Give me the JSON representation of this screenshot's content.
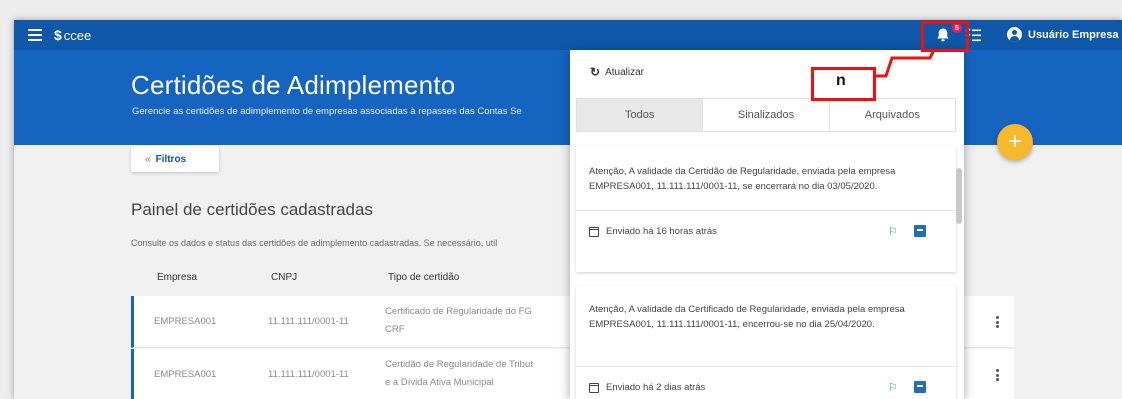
{
  "topbar": {
    "brand": "ccee",
    "notification_count": "5",
    "user_label": "Usuário Empresa"
  },
  "hero": {
    "title": "Certidões de Adimplemento",
    "subtitle": "Gerencie as certidões de adimplemento de empresas associadas à repasses das Contas Se"
  },
  "filters": {
    "label": "Filtros"
  },
  "panel": {
    "title": "Painel de certidões cadastradas",
    "description": "Consulte os dados e status das certidões de adimplemento cadastradas. Se necessário, util"
  },
  "table": {
    "columns": [
      "Empresa",
      "CNPJ",
      "Tipo de certidão"
    ],
    "rows": [
      {
        "empresa": "EMPRESA001",
        "cnpj": "11.111.111/0001-11",
        "tipo_line1": "Certificado de Regularidade do FG",
        "tipo_line2": "CRF"
      },
      {
        "empresa": "EMPRESA001",
        "cnpj": "11.111.111/0001-11",
        "tipo_line1": "Certidão de Regularidade de Tribut",
        "tipo_line2": "e a Dívida Ativa Municipal"
      }
    ]
  },
  "fab": {
    "label": "+"
  },
  "notifications": {
    "refresh_label": "Atualizar",
    "tabs": [
      "Todos",
      "Sinalizados",
      "Arquivados"
    ],
    "active_tab": "Todos",
    "items": [
      {
        "message": "Atenção, A validade da Certidão de Regularidade, enviada pela empresa EMPRESA001, 11.111.111/0001-11, se encerrará no dia 03/05/2020.",
        "sent": "Enviado há 16 horas atrás"
      },
      {
        "message": "Atenção, A validade da Certificado de Regularidade, enviada pela empresa EMPRESA001, 11.111.111/0001-11, encerrou-se no dia 25/04/2020.",
        "sent": "Enviado há 2 dias atrás"
      }
    ]
  },
  "annotation": {
    "letter": "n",
    "color": "#ee1111"
  },
  "colors": {
    "primary": "#0f57a8",
    "hero": "#1565c0",
    "fab": "#f9b72b",
    "badge": "#e91e63"
  }
}
